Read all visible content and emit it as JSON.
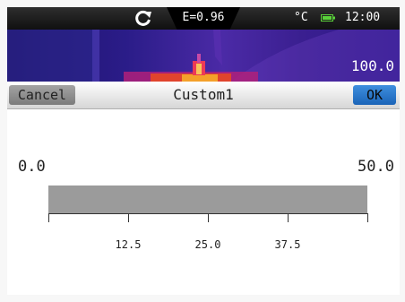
{
  "status": {
    "emissivity": "E=0.96",
    "unit": "°C",
    "time": "12:00",
    "icons": [
      "refresh-icon",
      "battery-icon"
    ]
  },
  "thermal": {
    "max_temp": "100.0"
  },
  "header": {
    "cancel_label": "Cancel",
    "title": "Custom1",
    "ok_label": "OK"
  },
  "range": {
    "min": "0.0",
    "max": "50.0",
    "ticks": [
      "12.5",
      "25.0",
      "37.5"
    ]
  },
  "colors": {
    "ok_button": "#2a78cc",
    "cancel_button": "#8f8f8f",
    "bar": "#9b9b9b"
  }
}
